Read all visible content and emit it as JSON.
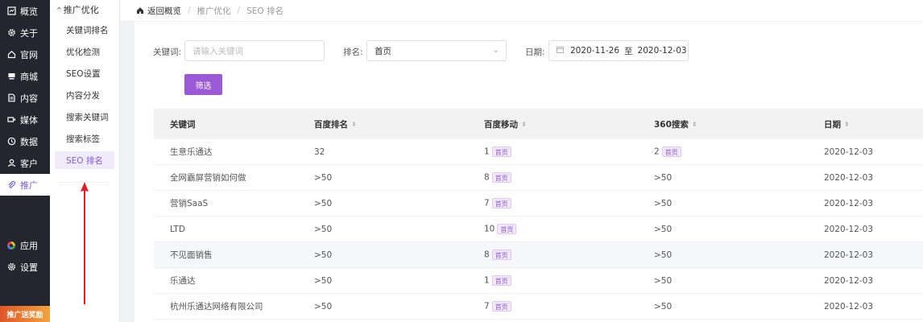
{
  "leftnav": {
    "items": [
      {
        "label": "概览",
        "icon": "dashboard-icon"
      },
      {
        "label": "关于",
        "icon": "gear-icon"
      },
      {
        "label": "官网",
        "icon": "home-icon"
      },
      {
        "label": "商城",
        "icon": "shop-icon"
      },
      {
        "label": "内容",
        "icon": "document-icon"
      },
      {
        "label": "媒体",
        "icon": "video-icon"
      },
      {
        "label": "数据",
        "icon": "clock-icon"
      },
      {
        "label": "客户",
        "icon": "user-icon"
      },
      {
        "label": "推广",
        "icon": "paperclip-icon"
      }
    ],
    "bottom_items": [
      {
        "label": "应用",
        "icon": "apps-icon"
      },
      {
        "label": "设置",
        "icon": "settings-icon"
      }
    ],
    "promo": "推广送奖励"
  },
  "submenu": {
    "group_title": "推广优化",
    "items": [
      "关键词排名",
      "优化检测",
      "SEO设置",
      "内容分发",
      "搜索关键词",
      "搜索标签",
      "SEO 排名"
    ]
  },
  "breadcrumb": {
    "home": "返回概览",
    "level1": "推广优化",
    "level2": "SEO 排名"
  },
  "filters": {
    "keyword_label": "关键词:",
    "keyword_placeholder": "请输入关键词",
    "rank_label": "排名:",
    "rank_value": "首页",
    "date_label": "日期:",
    "date_from": "2020-11-26",
    "date_to_sep": "至",
    "date_to": "2020-12-03",
    "filter_button": "筛选"
  },
  "table": {
    "headers": [
      "关键词",
      "百度排名",
      "百度移动",
      "360搜索",
      "日期"
    ],
    "rows": [
      {
        "keyword": "生意乐通达",
        "baidu": "32",
        "mobile": "1",
        "mobile_tag": "首页",
        "so360": "2",
        "so360_tag": "首页",
        "date": "2020-12-03"
      },
      {
        "keyword": "全网霸屏营销如何做",
        "baidu": ">50",
        "mobile": "8",
        "mobile_tag": "首页",
        "so360": ">50",
        "so360_tag": "",
        "date": "2020-12-03"
      },
      {
        "keyword": "营销SaaS",
        "baidu": ">50",
        "mobile": "7",
        "mobile_tag": "首页",
        "so360": ">50",
        "so360_tag": "",
        "date": "2020-12-03"
      },
      {
        "keyword": "LTD",
        "baidu": ">50",
        "mobile": "10",
        "mobile_tag": "首页",
        "so360": ">50",
        "so360_tag": "",
        "date": "2020-12-03"
      },
      {
        "keyword": "不见面销售",
        "baidu": ">50",
        "mobile": "8",
        "mobile_tag": "首页",
        "so360": ">50",
        "so360_tag": "",
        "date": "2020-12-03"
      },
      {
        "keyword": "乐通达",
        "baidu": ">50",
        "mobile": "1",
        "mobile_tag": "首页",
        "so360": ">50",
        "so360_tag": "",
        "date": "2020-12-03"
      },
      {
        "keyword": "杭州乐通达网络有限公司",
        "baidu": ">50",
        "mobile": "7",
        "mobile_tag": "首页",
        "so360": ">50",
        "so360_tag": "",
        "date": "2020-12-03"
      }
    ]
  },
  "colors": {
    "accent": "#9b59d7",
    "nav_bg": "#23262e",
    "annotation_arrow": "#e02020"
  }
}
